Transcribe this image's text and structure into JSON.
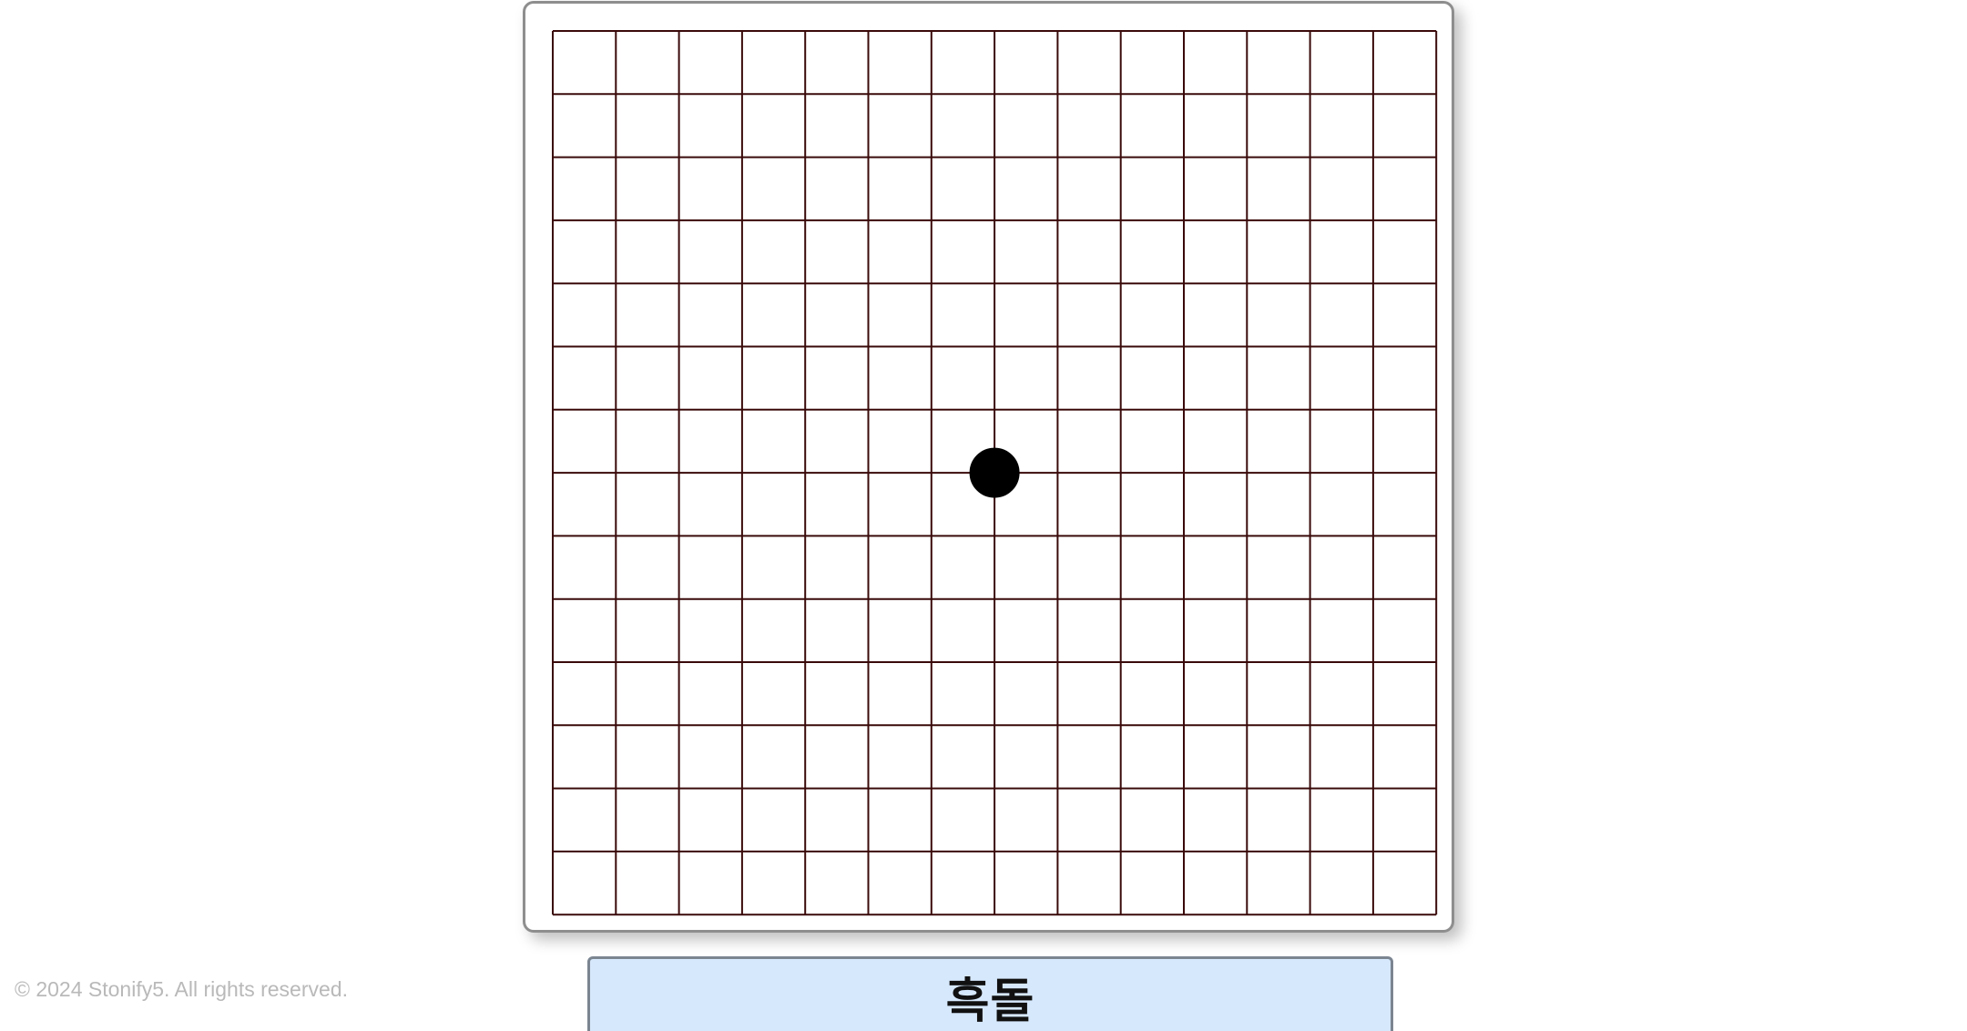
{
  "board": {
    "lines": 15,
    "line_color": "#3a0a0a",
    "background_color": "#ffffff",
    "stones": [
      {
        "color": "black",
        "col": 7,
        "row": 7
      }
    ]
  },
  "turn_indicator": {
    "label": "흑돌",
    "background_color": "#d6e8fc"
  },
  "footer": {
    "copyright": "© 2024 Stonify5. All rights reserved."
  }
}
